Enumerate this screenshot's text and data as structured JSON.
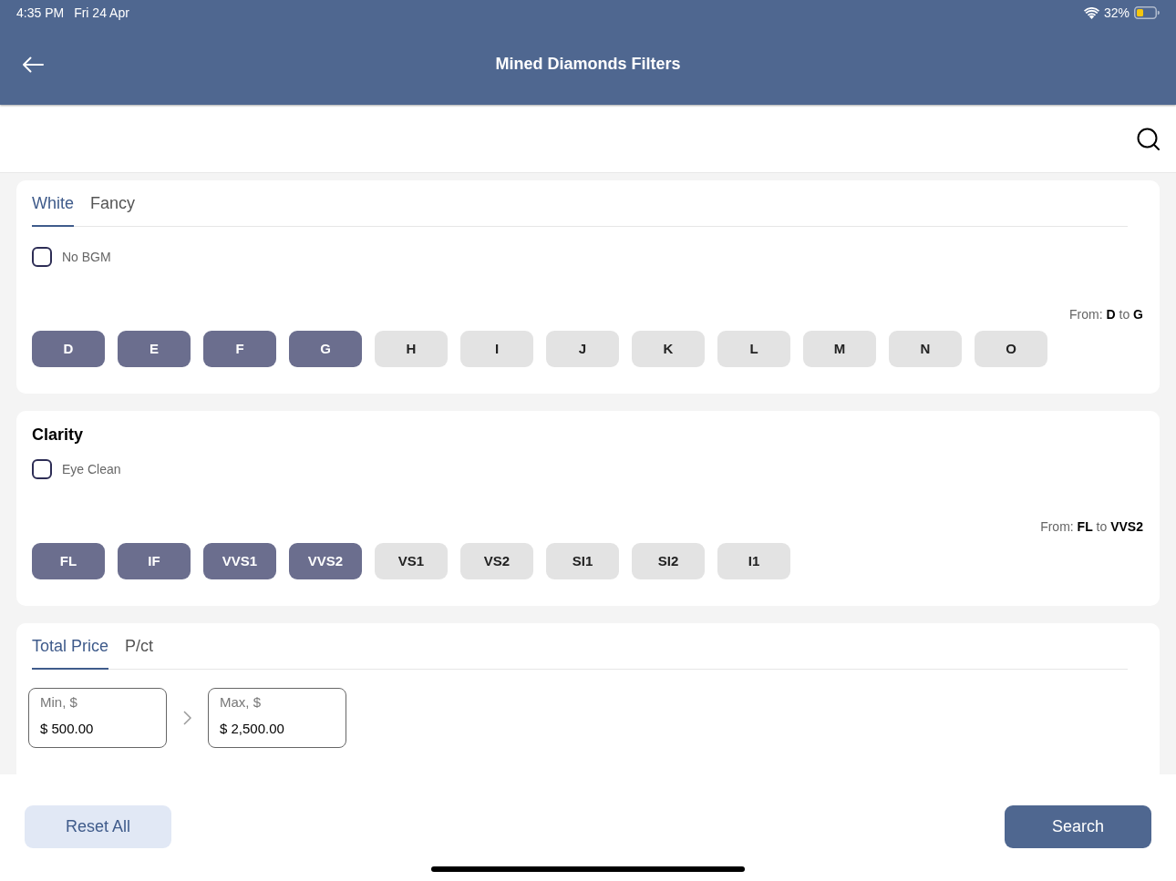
{
  "status_bar": {
    "time": "4:35 PM",
    "date": "Fri 24 Apr",
    "battery": "32%"
  },
  "header": {
    "title": "Mined Diamonds Filters"
  },
  "color_section": {
    "tabs": [
      {
        "label": "White",
        "selected": true
      },
      {
        "label": "Fancy",
        "selected": false
      }
    ],
    "options": [
      {
        "label": "No BGM",
        "checked": false
      }
    ],
    "range": "From: **D** to **G**",
    "grades": [
      {
        "label": "D",
        "selected": true
      },
      {
        "label": "E",
        "selected": true
      },
      {
        "label": "F",
        "selected": true
      },
      {
        "label": "G",
        "selected": true
      },
      {
        "label": "H",
        "selected": false
      },
      {
        "label": "I",
        "selected": false
      },
      {
        "label": "J",
        "selected": false
      },
      {
        "label": "K",
        "selected": false
      },
      {
        "label": "L",
        "selected": false
      },
      {
        "label": "M",
        "selected": false
      },
      {
        "label": "N",
        "selected": false
      },
      {
        "label": "O",
        "selected": false
      }
    ]
  },
  "clarity_section": {
    "title": "Clarity",
    "options": [
      {
        "label": "Eye Clean",
        "checked": false
      }
    ],
    "range": "From: **FL** to **VVS2**",
    "grades": [
      {
        "label": "FL",
        "selected": true
      },
      {
        "label": "IF",
        "selected": true
      },
      {
        "label": "VVS1",
        "selected": true
      },
      {
        "label": "VVS2",
        "selected": true
      },
      {
        "label": "VS1",
        "selected": false
      },
      {
        "label": "VS2",
        "selected": false
      },
      {
        "label": "SI1",
        "selected": false
      },
      {
        "label": "SI2",
        "selected": false
      },
      {
        "label": "I1",
        "selected": false
      }
    ]
  },
  "price_section": {
    "tabs": [
      {
        "label": "Total Price",
        "selected": true
      },
      {
        "label": "P/ct",
        "selected": false
      }
    ],
    "fields": [
      {
        "label": "Min, $",
        "value": "$ 500.00"
      },
      {
        "label": "Max, $",
        "value": "$ 2,500.00"
      }
    ]
  },
  "footer": {
    "buttons": [
      {
        "label": "Reset All",
        "kind": "secondary"
      },
      {
        "label": "Search",
        "kind": "primary"
      }
    ]
  }
}
